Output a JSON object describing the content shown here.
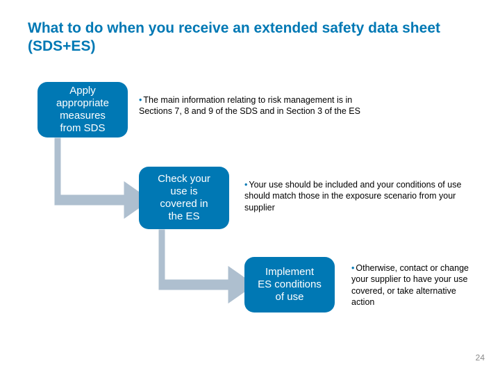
{
  "title": "What to do when you receive an extended safety data sheet (SDS+ES)",
  "steps": [
    {
      "label": "Apply\nappropriate\nmeasures\nfrom SDS",
      "note": "The main information relating to risk management is in Sections 7, 8 and 9 of the SDS and in Section 3 of the ES"
    },
    {
      "label": "Check your\nuse is\ncovered in\nthe ES",
      "note": "Your use should be included and your conditions of use should match those in the exposure scenario from your supplier"
    },
    {
      "label": "Implement\nES conditions\nof use",
      "note": "Otherwise, contact or change your supplier to have your use covered, or take alternative action"
    }
  ],
  "page_number": "24",
  "colors": {
    "accent": "#0078b4",
    "arrow": "#aebfcf"
  }
}
